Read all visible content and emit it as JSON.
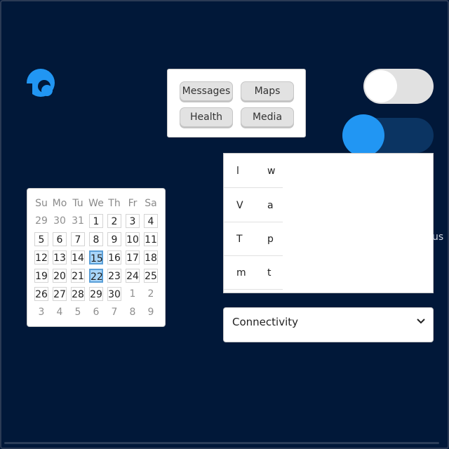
{
  "buttons": [
    "Messages",
    "Maps",
    "Health",
    "Media"
  ],
  "toggles": [
    {
      "state": "off"
    },
    {
      "state": "on"
    }
  ],
  "list": {
    "rows": [
      [
        "l",
        "w"
      ],
      [
        "V",
        "a"
      ],
      [
        "T",
        "p"
      ],
      [
        "m",
        "t"
      ]
    ]
  },
  "overflow_text": "us",
  "calendar": {
    "weekdays": [
      "Su",
      "Mo",
      "Tu",
      "We",
      "Th",
      "Fr",
      "Sa"
    ],
    "days": [
      [
        "29",
        "30",
        "31",
        "1",
        "2",
        "3",
        "4"
      ],
      [
        "5",
        "6",
        "7",
        "8",
        "9",
        "10",
        "11"
      ],
      [
        "12",
        "13",
        "14",
        "15",
        "16",
        "17",
        "18"
      ],
      [
        "19",
        "20",
        "21",
        "22",
        "23",
        "24",
        "25"
      ],
      [
        "26",
        "27",
        "28",
        "29",
        "30",
        "1",
        "2"
      ],
      [
        "3",
        "4",
        "5",
        "6",
        "7",
        "8",
        "9"
      ]
    ],
    "selected": [
      "15",
      "22"
    ]
  },
  "dropdown": {
    "selected": "Connectivity"
  },
  "colors": {
    "accent": "#2196f3",
    "background": "#011839"
  }
}
